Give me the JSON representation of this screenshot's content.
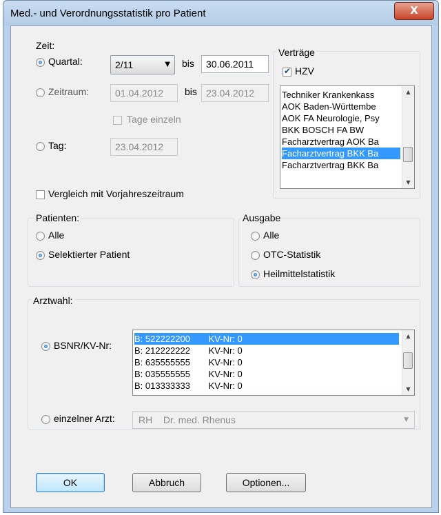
{
  "window": {
    "title": "Med.- und Verordnungsstatistik pro Patient",
    "close_label": "X"
  },
  "zeit": {
    "group_label": "Zeit:",
    "quartal_label": "Quartal:",
    "quartal_value": "2/11",
    "bis_label": "bis",
    "quartal_bis_value": "30.06.2011",
    "zeitraum_label": "Zeitraum:",
    "zeitraum_from": "01.04.2012",
    "zeitraum_bis_label": "bis",
    "zeitraum_to": "23.04.2012",
    "tage_einzeln_label": "Tage einzeln",
    "tag_label": "Tag:",
    "tag_value": "23.04.2012",
    "vergleich_label": "Vergleich mit Vorjahreszeitraum"
  },
  "vertraege": {
    "group_label": "Verträge",
    "hzv_label": "HZV",
    "items": [
      "Techniker Krankenkass",
      "AOK Baden-Württembe",
      "AOK FA Neurologie, Psy",
      "BKK BOSCH FA BW",
      "Facharztvertrag AOK Ba",
      "Facharztvertrag BKK Ba",
      "Facharztvertrag BKK Ba"
    ],
    "selected_index": 5
  },
  "patienten": {
    "group_label": "Patienten:",
    "alle_label": "Alle",
    "selektiert_label": "Selektierter Patient"
  },
  "ausgabe": {
    "group_label": "Ausgabe",
    "alle_label": "Alle",
    "otc_label": "OTC-Statistik",
    "heilmittel_label": "Heilmittelstatistik"
  },
  "arztwahl": {
    "group_label": "Arztwahl:",
    "bsnr_label": "BSNR/KV-Nr:",
    "rows": [
      {
        "bsnr": "B: 522222200",
        "kv": "KV-Nr: 0"
      },
      {
        "bsnr": "B: 212222222",
        "kv": "KV-Nr: 0"
      },
      {
        "bsnr": "B: 635555555",
        "kv": "KV-Nr: 0"
      },
      {
        "bsnr": "B: 035555555",
        "kv": "KV-Nr: 0"
      },
      {
        "bsnr": "B: 013333333",
        "kv": "KV-Nr: 0"
      }
    ],
    "einzelner_label": "einzelner Arzt:",
    "arzt_kuerzel": "RH",
    "arzt_name": "Dr. med. Rhenus"
  },
  "buttons": {
    "ok": "OK",
    "abbruch": "Abbruch",
    "optionen": "Optionen..."
  },
  "colors": {
    "selection": "#3399ff",
    "frame": "#b9d1ea"
  }
}
